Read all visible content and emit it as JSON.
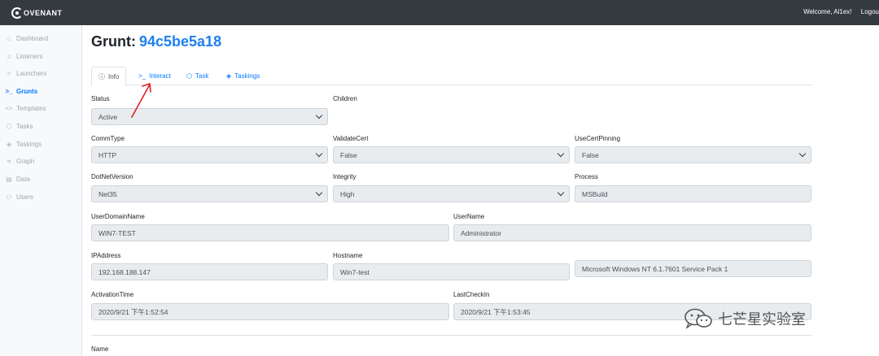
{
  "navbar": {
    "logo_text": "OVENANT",
    "welcome": "Welcome, Al1ex!",
    "logout": "Logou"
  },
  "sidebar": {
    "items": [
      {
        "label": "Dashboard",
        "icon": "home-icon"
      },
      {
        "label": "Listeners",
        "icon": "headphones-icon"
      },
      {
        "label": "Launchers",
        "icon": "rocket-icon"
      },
      {
        "label": "Grunts",
        "icon": "terminal-icon"
      },
      {
        "label": "Templates",
        "icon": "code-icon"
      },
      {
        "label": "Tasks",
        "icon": "box-icon"
      },
      {
        "label": "Taskings",
        "icon": "layers-icon"
      },
      {
        "label": "Graph",
        "icon": "share-icon"
      },
      {
        "label": "Data",
        "icon": "database-icon"
      },
      {
        "label": "Users",
        "icon": "users-icon"
      }
    ],
    "active": "Grunts"
  },
  "page": {
    "title_prefix": "Grunt:",
    "grunt_id": "94c5be5a18"
  },
  "tabs": [
    {
      "label": "Info",
      "icon": "info-icon"
    },
    {
      "label": "Interact",
      "icon": "terminal-icon"
    },
    {
      "label": "Task",
      "icon": "box-icon"
    },
    {
      "label": "Taskings",
      "icon": "layers-icon"
    }
  ],
  "fields": {
    "status": {
      "label": "Status",
      "value": "Active"
    },
    "children": {
      "label": "Children"
    },
    "commtype": {
      "label": "CommType",
      "value": "HTTP"
    },
    "validatecert": {
      "label": "ValidateCert",
      "value": "False"
    },
    "usecertpinning": {
      "label": "UseCertPinning",
      "value": "False"
    },
    "dotnetversion": {
      "label": "DotNetVersion",
      "value": "Net35"
    },
    "integrity": {
      "label": "Integrity",
      "value": "High"
    },
    "process": {
      "label": "Process",
      "value": "MSBuild"
    },
    "userdomainname": {
      "label": "UserDomainName",
      "value": "WIN7-TEST"
    },
    "username": {
      "label": "UserName",
      "value": "Administrator"
    },
    "ipaddress": {
      "label": "IPAddress",
      "value": "192.168.188.147"
    },
    "hostname": {
      "label": "Hostname",
      "value": "Win7-test"
    },
    "os": {
      "value": "Microsoft Windows NT 6.1.7601 Service Pack 1"
    },
    "activationtime": {
      "label": "ActivationTime",
      "value": "2020/9/21 下午1:52:54"
    },
    "lastcheckin": {
      "label": "LastCheckIn",
      "value": "2020/9/21 下午1:53:45"
    },
    "name": {
      "label": "Name"
    }
  },
  "watermark": {
    "text": "七芒星实验室",
    "icon": "wechat-icon"
  },
  "colors": {
    "navbar": "#343a40",
    "accent": "#007bff",
    "annotation_arrow": "#e02020"
  }
}
